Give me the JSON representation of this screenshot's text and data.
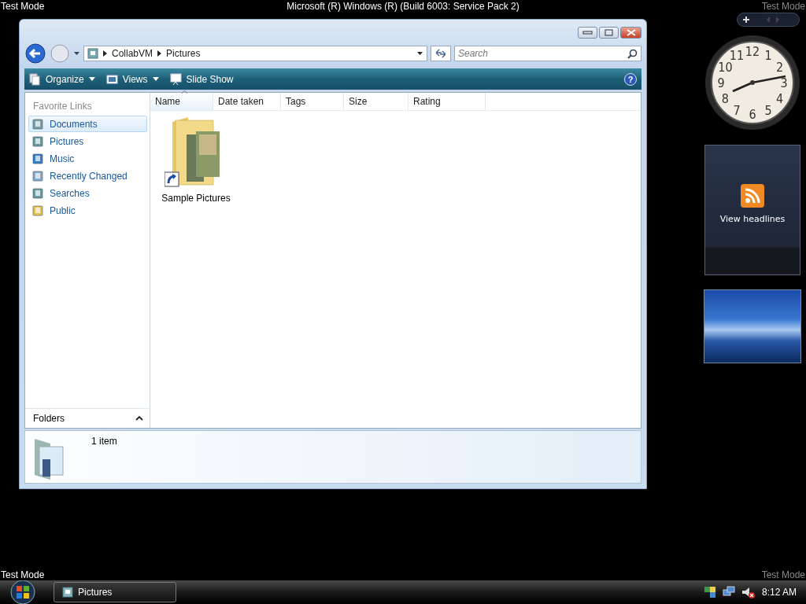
{
  "top_bar": {
    "left_label": "Test Mode",
    "title": "Microsoft (R) Windows (R) (Build 6003: Service Pack 2)",
    "right_label": "Test Mode"
  },
  "explorer": {
    "breadcrumb": [
      "CollabVM",
      "Pictures"
    ],
    "search": {
      "placeholder": "Search"
    },
    "help_label": "?",
    "toolbar": [
      {
        "label": "Organize",
        "kind": "organize",
        "has_menu": true
      },
      {
        "label": "Views",
        "kind": "views",
        "has_menu": true
      },
      {
        "label": "Slide Show",
        "kind": "slideshow",
        "has_menu": false
      }
    ],
    "favorite_links": {
      "heading": "Favorite Links",
      "items": [
        {
          "label": "Documents",
          "kind": "documents",
          "selected": true
        },
        {
          "label": "Pictures",
          "kind": "pictures",
          "selected": false
        },
        {
          "label": "Music",
          "kind": "music",
          "selected": false
        },
        {
          "label": "Recently Changed",
          "kind": "recent",
          "selected": false
        },
        {
          "label": "Searches",
          "kind": "searches",
          "selected": false
        },
        {
          "label": "Public",
          "kind": "public",
          "selected": false
        }
      ]
    },
    "folders_label": "Folders",
    "columns": [
      {
        "label": "Name",
        "sorted": true
      },
      {
        "label": "Date taken",
        "sorted": false
      },
      {
        "label": "Tags",
        "sorted": false
      },
      {
        "label": "Size",
        "sorted": false
      },
      {
        "label": "Rating",
        "sorted": false
      }
    ],
    "items": [
      {
        "name": "Sample Pictures",
        "shortcut": true
      }
    ],
    "status": "1 item"
  },
  "gadgets": {
    "clock_numerals": [
      "11",
      "12",
      "1",
      "10",
      "2",
      "9",
      "3",
      "8",
      "4",
      "7",
      "6",
      "5"
    ],
    "feed_label": "View headlines"
  },
  "bottom_labels": {
    "left": "Test Mode",
    "right": "Test Mode"
  },
  "taskbar": {
    "tasks": [
      {
        "label": "Pictures",
        "selected": false
      }
    ],
    "volume_muted": true,
    "clock": "8:12 AM"
  }
}
